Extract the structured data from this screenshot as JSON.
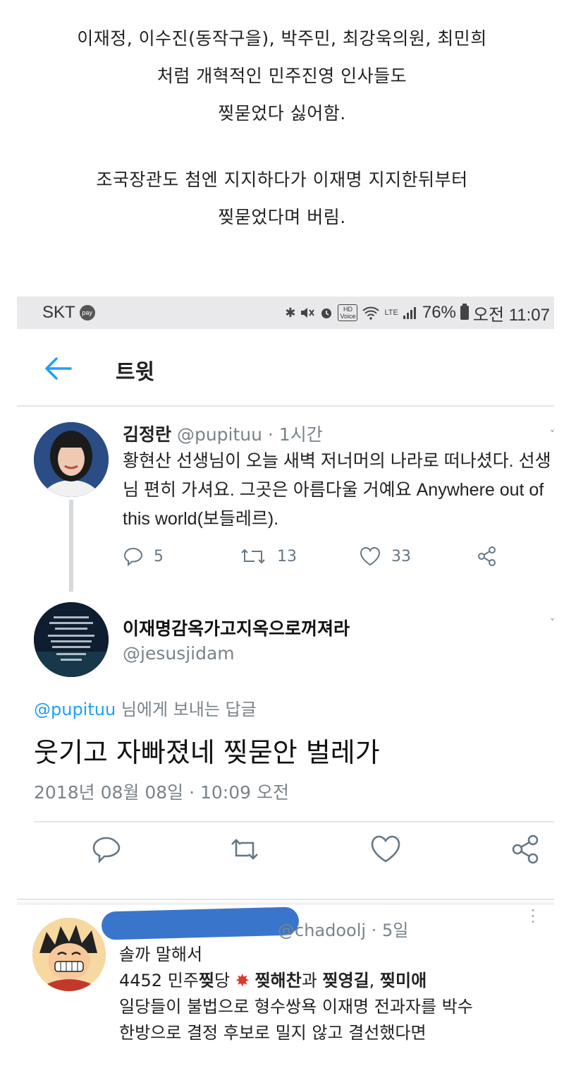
{
  "caption": {
    "lines": [
      "이재정, 이수진(동작구을), 박주민, 최강욱의원, 최민희",
      "처럼 개혁적인 민주진영 인사들도",
      "찢묻었다 싫어함.",
      "",
      "조국장관도 첨엔 지지하다가 이재명 지지한뒤부터",
      "찢묻었다며 버림."
    ]
  },
  "statusbar": {
    "carrier": "SKT",
    "pay": "pay",
    "hd": "HD",
    "voice": "Voice",
    "lte": "LTE",
    "battery": "76%",
    "time": "오전 11:07"
  },
  "header": {
    "title": "트윗"
  },
  "tweet1": {
    "name": "김정란",
    "meta": "@pupituu · 1시간",
    "body": "황현산 선생님이 오늘 새벽 저너머의 나라로 떠나셨다. 선생님 편히 가셔요. 그곳은 아름다울 거예요 Anywhere out of this world(보들레르).",
    "replies": "5",
    "retweets": "13",
    "likes": "33"
  },
  "tweet2": {
    "name": "이재명감옥가고지옥으로꺼져라",
    "handle": "@jesusjidam",
    "reply_mention": "@pupituu",
    "reply_suffix": " 님에게 보내는 답글",
    "text": "웃기고 자빠졌네 찢묻안 벌레가",
    "date": "2018년 08월 08일 · 10:09 오전"
  },
  "tweet3": {
    "meta": "@chadoolj · 5일",
    "more": "⋮",
    "line1": "솔까 말해서",
    "line2_a": "4452  민주",
    "line2_b": "찢",
    "line2_c": "당 ",
    "burst": "✸",
    "line2_d": " ",
    "line2_e": "찢해찬",
    "line2_f": "과 ",
    "line2_g": "찢영길",
    "line2_h": ", ",
    "line2_i": "찢미애",
    "line3": "일당들이 불법으로 형수쌍욕 이재명 전과자를 박수",
    "line4": "한방으로 결정 후보로 밀지 않고 결선했다면"
  },
  "colors": {
    "accent": "#1da1f2",
    "muted": "#7a838a",
    "statusbar_bg": "#e9e9ec",
    "redaction": "#2f6ec9"
  },
  "icons": [
    "pay-icon",
    "bluetooth-icon",
    "mute-icon",
    "alarm-icon",
    "hd-voice-icon",
    "wifi-icon",
    "signal-icon",
    "battery-icon",
    "back-arrow-icon",
    "reply-icon",
    "retweet-icon",
    "like-icon",
    "share-icon",
    "more-icon"
  ]
}
